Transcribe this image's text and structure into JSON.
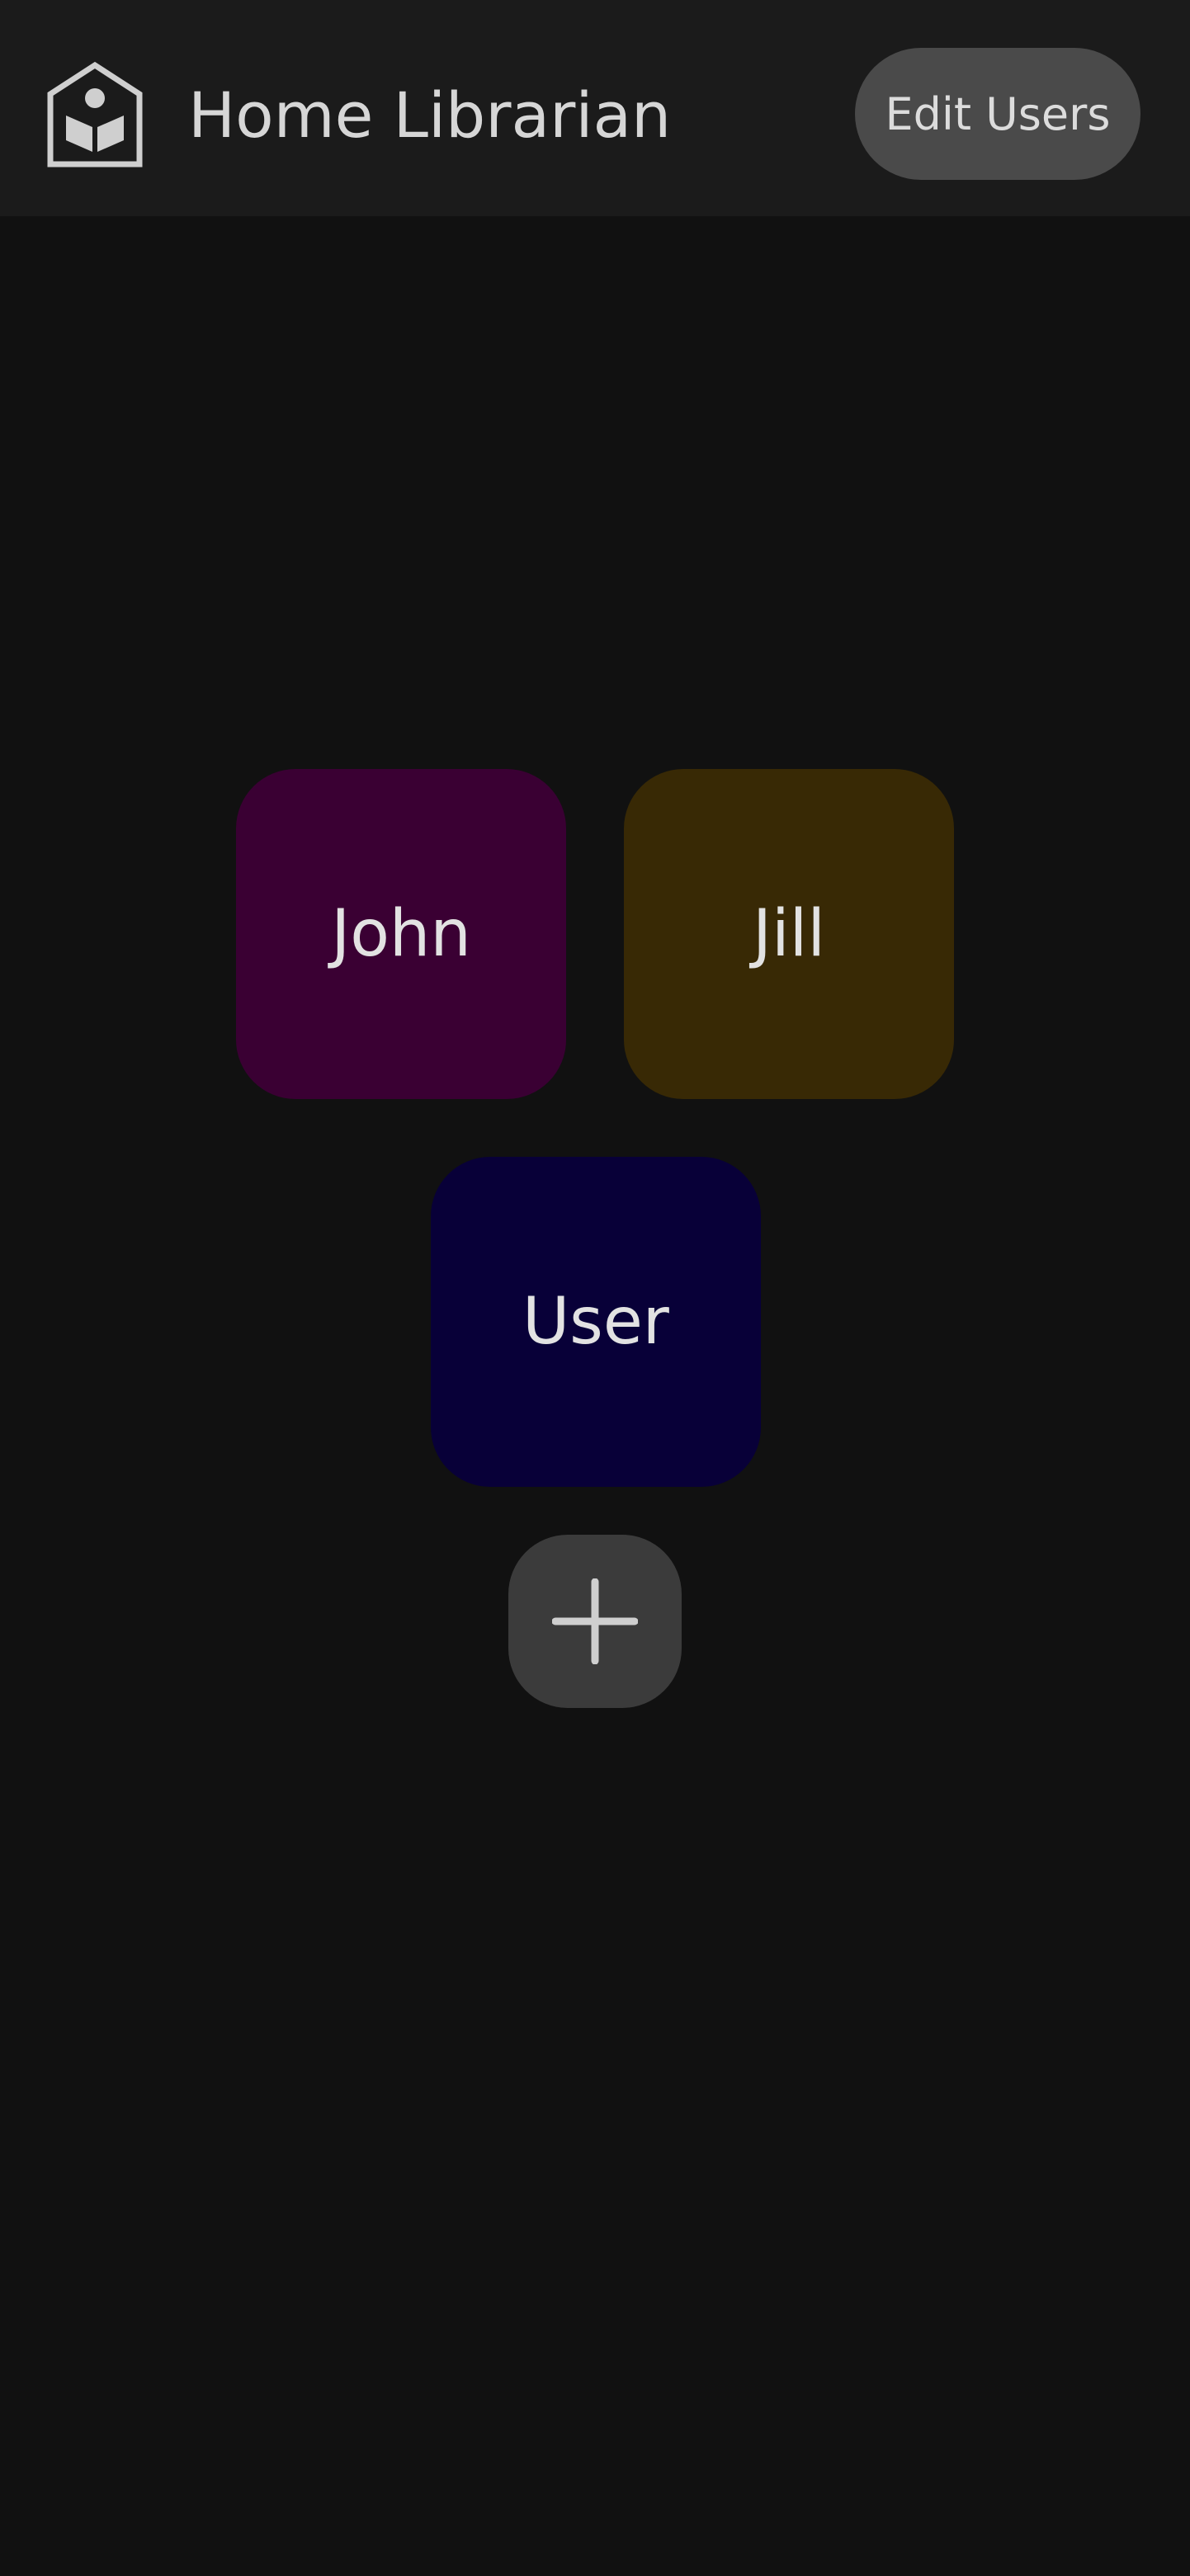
{
  "header": {
    "app_title": "Home Librarian",
    "logo_icon": "house-book-icon",
    "edit_users_label": "Edit Users"
  },
  "users": [
    {
      "name": "John",
      "color": "#3a0033"
    },
    {
      "name": "Jill",
      "color": "#382905"
    },
    {
      "name": "User",
      "color": "#080038"
    }
  ],
  "add_user": {
    "icon": "plus-icon"
  },
  "colors": {
    "background": "#111111",
    "header_background": "#1b1b1b",
    "button_background": "#4a4a4a",
    "add_button_background": "#3b3b3b",
    "text": "#d8d8d8"
  }
}
